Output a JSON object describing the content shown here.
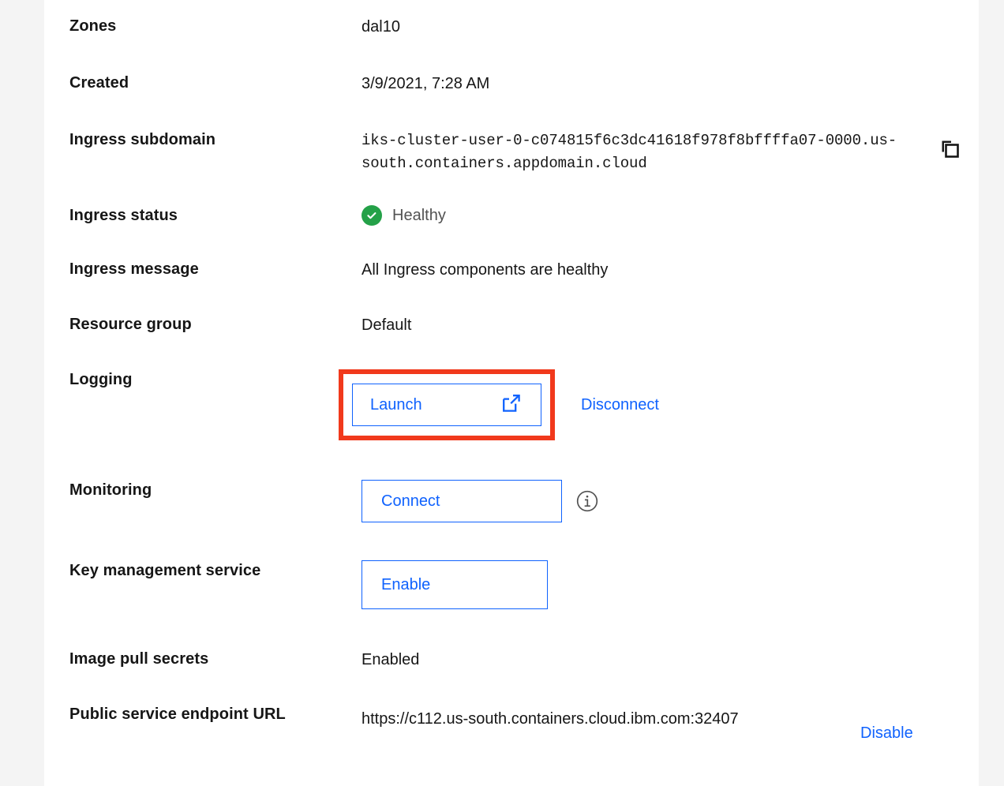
{
  "panel": {
    "rows": [
      {
        "label": "Zones",
        "value": "dal10"
      },
      {
        "label": "Created",
        "value": "3/9/2021, 7:28 AM"
      },
      {
        "label": "Ingress subdomain",
        "value": "iks-cluster-user-0-c074815f6c3dc41618f978f8bffffa07-0000.us-south.containers.appdomain.cloud"
      },
      {
        "label": "Ingress status",
        "value": "Healthy"
      },
      {
        "label": "Ingress message",
        "value": "All Ingress components are healthy"
      },
      {
        "label": "Resource group",
        "value": "Default"
      },
      {
        "label": "Logging",
        "value": ""
      },
      {
        "label": "Monitoring",
        "value": ""
      },
      {
        "label": "Key management service",
        "value": ""
      },
      {
        "label": "Image pull secrets",
        "value": "Enabled"
      },
      {
        "label": "Public service endpoint URL",
        "value": "https://c112.us-south.containers.cloud.ibm.com:32407"
      }
    ],
    "labels": {
      "zones": "Zones",
      "created": "Created",
      "ingress_subdomain": "Ingress subdomain",
      "ingress_status": "Ingress status",
      "ingress_message": "Ingress message",
      "resource_group": "Resource group",
      "logging": "Logging",
      "monitoring": "Monitoring",
      "key_management_service": "Key management service",
      "image_pull_secrets": "Image pull secrets",
      "public_service_endpoint_url": "Public service endpoint URL"
    },
    "values": {
      "zones": "dal10",
      "created": "3/9/2021, 7:28 AM",
      "ingress_subdomain": "iks-cluster-user-0-c074815f6c3dc41618f978f8bffffa07-0000.us-south.containers.appdomain.cloud",
      "ingress_status": "Healthy",
      "ingress_message": "All Ingress components are healthy",
      "resource_group": "Default",
      "image_pull_secrets": "Enabled",
      "public_service_endpoint_url": "https://c112.us-south.containers.cloud.ibm.com:32407"
    },
    "actions": {
      "logging_launch": "Launch",
      "logging_disconnect": "Disconnect",
      "monitoring_connect": "Connect",
      "kms_enable": "Enable",
      "endpoint_disable": "Disable"
    },
    "icons": {
      "copy": "copy-icon",
      "status_check": "check-circle-icon",
      "launch_external": "external-link-icon",
      "monitoring_info": "info-icon"
    }
  },
  "colors": {
    "page_background": "#f4f4f4",
    "panel_background": "#ffffff",
    "text_primary": "#161616",
    "text_secondary": "#525252",
    "link_blue": "#0f62fe",
    "status_green": "#24a148",
    "highlight_red": "#f1391c"
  },
  "annotation": {
    "type": "highlight-box",
    "target": "logging-launch-button",
    "color": "#f1391c"
  }
}
